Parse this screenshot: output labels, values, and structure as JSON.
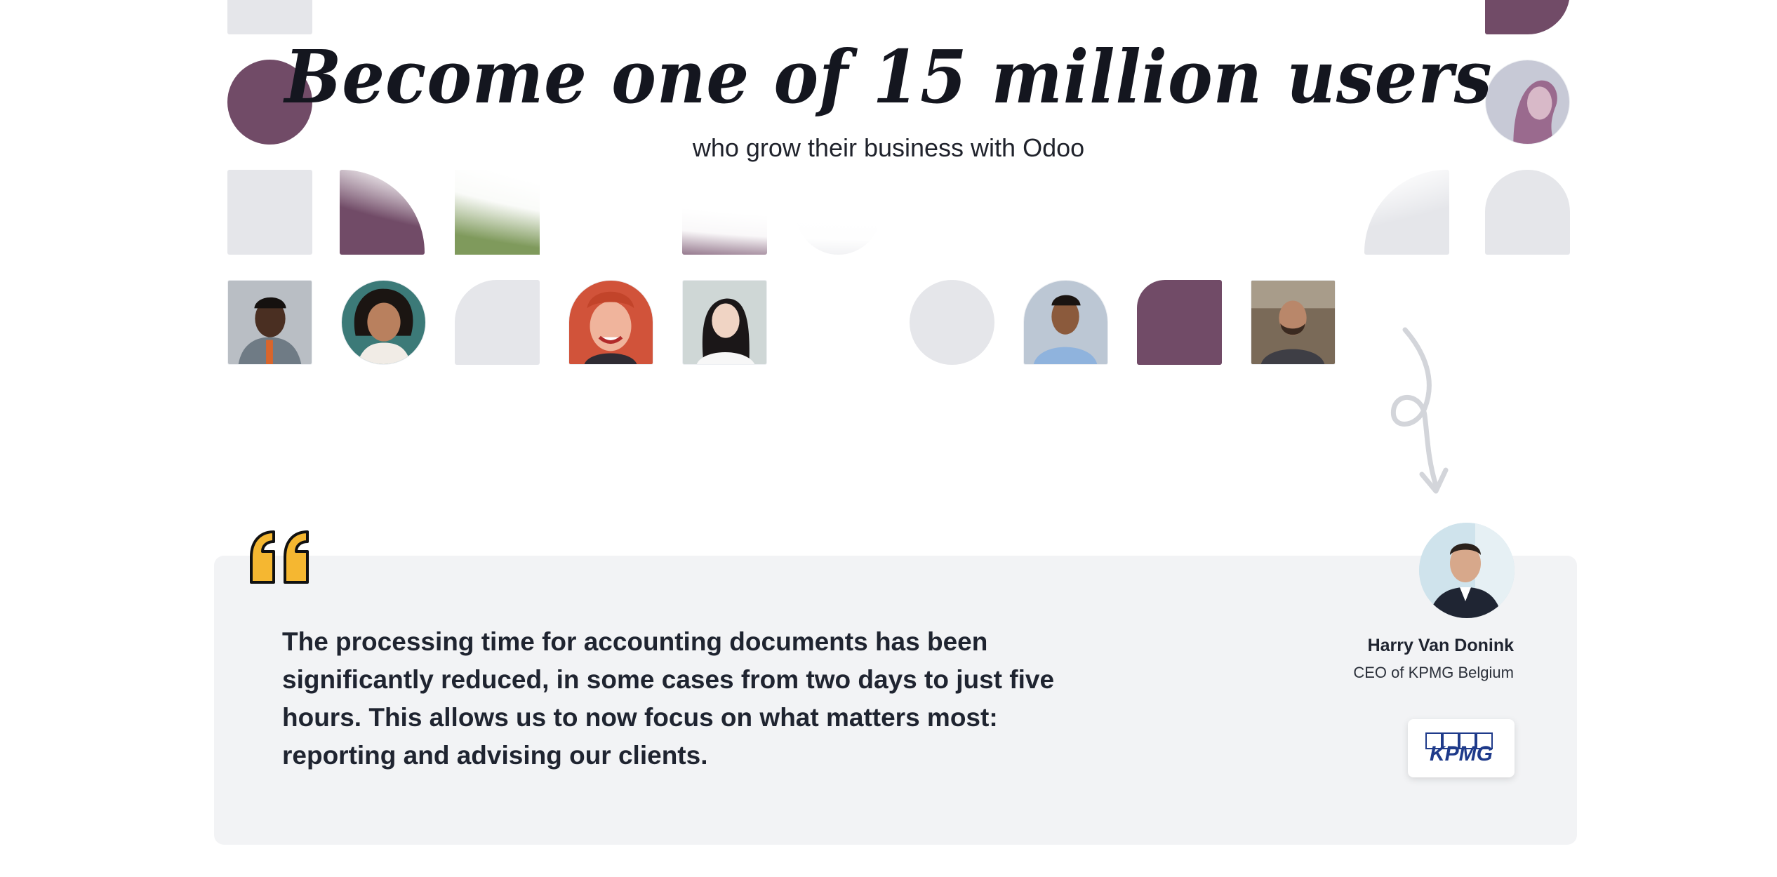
{
  "hero": {
    "title": "Become one of 15 million users",
    "subtitle": "who grow their business with Odoo"
  },
  "colors": {
    "brand_plum": "#714b67",
    "tile_gray": "#e5e6ea",
    "quote_yellow": "#f5b731",
    "card_bg": "#f2f3f5"
  },
  "testimonial": {
    "quote": "The processing time for accounting documents has been significantly reduced, in some cases from two days to just five hours. This allows us to now focus on what matters most: reporting and advising our clients.",
    "author_name": "Harry Van Donink",
    "author_role": "CEO of KPMG Belgium",
    "company_logo_text": "KPMG",
    "quote_icon": "quote-icon",
    "arrow_icon": "curly-arrow-icon"
  }
}
